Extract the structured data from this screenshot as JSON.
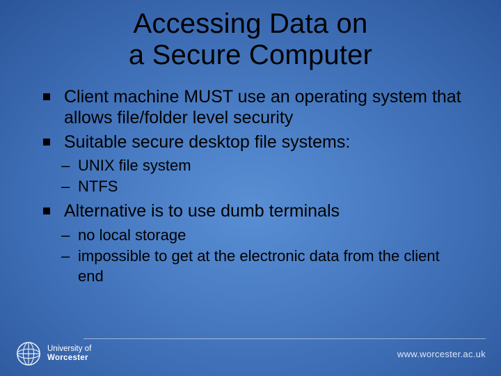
{
  "title_line1": "Accessing Data on",
  "title_line2": "a Secure Computer",
  "bullets": {
    "b1": "Client machine MUST use an operating system that allows file/folder level security",
    "b2": "Suitable secure desktop file systems:",
    "sub2": {
      "s1": "UNIX file system",
      "s2": "NTFS"
    },
    "b3": "Alternative is to use dumb terminals",
    "sub3": {
      "s1": "no local storage",
      "s2": "impossible to get at the electronic data from the client end"
    }
  },
  "footer": {
    "org_line1": "University of",
    "org_line2": "Worcester",
    "url": "www.worcester.ac.uk"
  }
}
